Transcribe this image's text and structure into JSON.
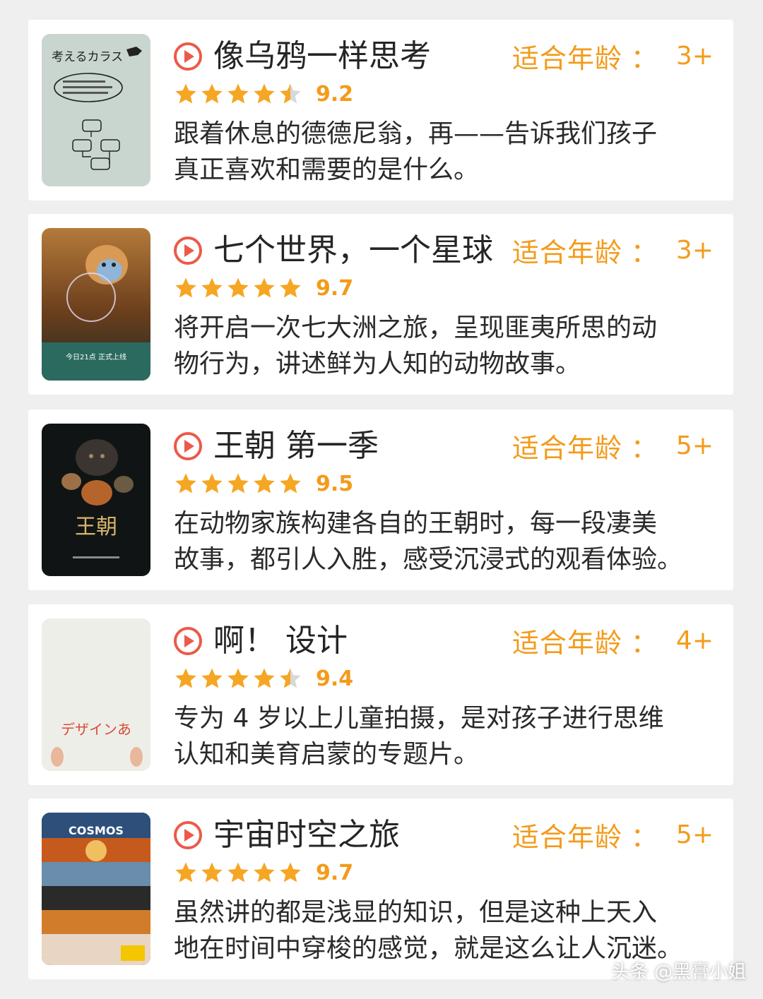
{
  "colors": {
    "accent": "#f39b1b",
    "play_icon": "#ec5a49",
    "star_filled": "#f5a623",
    "star_empty": "#d8d8d8",
    "card_bg": "#ffffff",
    "page_bg": "#efefef"
  },
  "icons": {
    "play": "play-circle-icon",
    "star": "star-icon"
  },
  "items": [
    {
      "title": "像乌鸦一样思考",
      "rating_stars": 4.5,
      "score": "9.2",
      "age_label": "适合年龄",
      "age_colon": "：",
      "age_value": "3+",
      "desc_lines": [
        "跟着休息的德德尼翁，再——告诉我们孩子",
        "真正喜欢和需要的是什么。"
      ],
      "poster_text": "考えるカラス"
    },
    {
      "title": "七个世界，一个星球",
      "rating_stars": 5,
      "score": "9.7",
      "age_label": "适合年龄",
      "age_colon": "：",
      "age_value": "3+",
      "desc_lines": [
        "将开启一次七大洲之旅，呈现匪夷所思的动",
        "物行为，讲述鲜为人知的动物故事。"
      ],
      "poster_text": "今日21点 正式上线"
    },
    {
      "title": "王朝 第一季",
      "rating_stars": 5,
      "score": "9.5",
      "age_label": "适合年龄",
      "age_colon": "：",
      "age_value": "5+",
      "desc_lines": [
        "在动物家族构建各自的王朝时，每一段凄美",
        "故事，都引人入胜，感受沉浸式的观看体验。"
      ],
      "poster_text": "王朝"
    },
    {
      "title": "啊！ 设计",
      "rating_stars": 4.5,
      "score": "9.4",
      "age_label": "适合年龄",
      "age_colon": "：",
      "age_value": "4+",
      "desc_lines": [
        "专为 4 岁以上儿童拍摄，是对孩子进行思维",
        "认知和美育启蒙的专题片。"
      ],
      "poster_text": "デザインあ"
    },
    {
      "title": "宇宙时空之旅",
      "rating_stars": 5,
      "score": "9.7",
      "age_label": "适合年龄",
      "age_colon": "：",
      "age_value": "5+",
      "desc_lines": [
        "虽然讲的都是浅显的知识，但是这种上天入",
        "地在时间中穿梭的感觉，就是这么让人沉迷。"
      ],
      "poster_text": "COSMOS"
    }
  ],
  "watermark": "头条 @黑膏小姐"
}
